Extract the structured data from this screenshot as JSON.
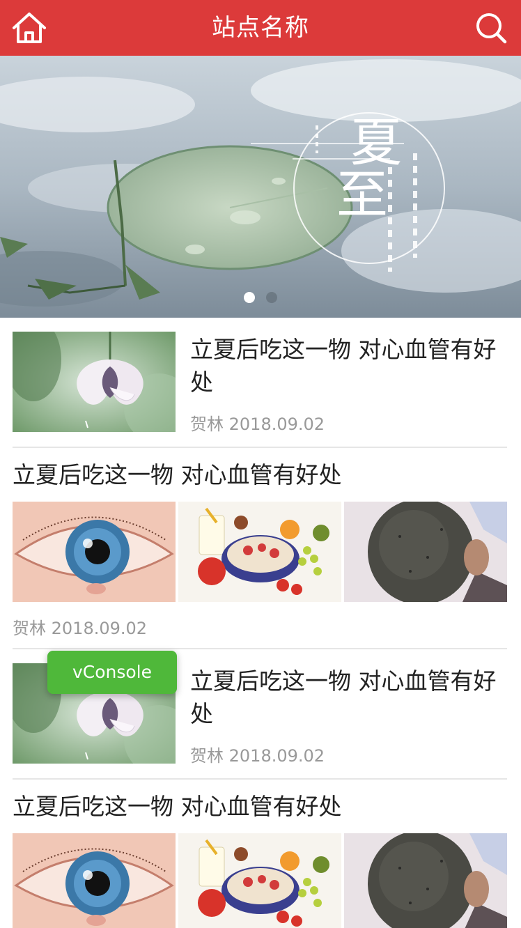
{
  "header": {
    "title": "站点名称",
    "home_icon": "home-icon",
    "search_icon": "search-icon",
    "background": "#dc3a3a"
  },
  "banner": {
    "calligraphy": "夏至",
    "slide_count": 2,
    "active_slide": 1
  },
  "articles": [
    {
      "layout": "single",
      "title": "立夏后吃这一物 对心血管有好处",
      "author": "贺林",
      "date": "2018.09.02"
    },
    {
      "layout": "triple",
      "title": "立夏后吃这一物 对心血管有好处",
      "author": "贺林",
      "date": "2018.09.02"
    },
    {
      "layout": "single",
      "title": "立夏后吃这一物 对心血管有好处",
      "author": "贺林",
      "date": "2018.09.02"
    },
    {
      "layout": "triple",
      "title": "立夏后吃这一物 对心血管有好处"
    }
  ],
  "vconsole": {
    "label": "vConsole",
    "color": "#4fb83a"
  }
}
